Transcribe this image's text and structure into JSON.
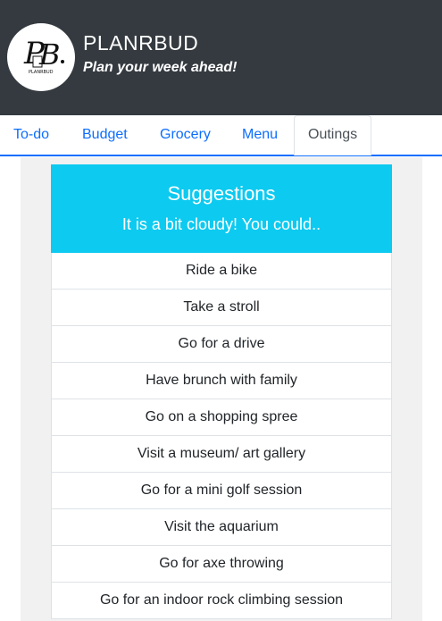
{
  "header": {
    "logo_text": "PB PLANRBUD",
    "title": "PLANRBUD",
    "tagline": "Plan your week ahead!"
  },
  "tabs": [
    {
      "label": "To-do",
      "active": false
    },
    {
      "label": "Budget",
      "active": false
    },
    {
      "label": "Grocery",
      "active": false
    },
    {
      "label": "Menu",
      "active": false
    },
    {
      "label": "Outings",
      "active": true
    }
  ],
  "suggestions": {
    "title": "Suggestions",
    "subtitle": "It is a bit cloudy! You could..",
    "items": [
      "Ride a bike",
      "Take a stroll",
      "Go for a drive",
      "Have brunch with family",
      "Go on a shopping spree",
      "Visit a museum/ art gallery",
      "Go for a mini golf session",
      "Visit the aquarium",
      "Go for axe throwing",
      "Go for an indoor rock climbing session"
    ]
  },
  "colors": {
    "header_bg": "#343a40",
    "link": "#0d6efd",
    "card_header": "#0dcaf0",
    "content_bg": "#f1f1f1"
  }
}
